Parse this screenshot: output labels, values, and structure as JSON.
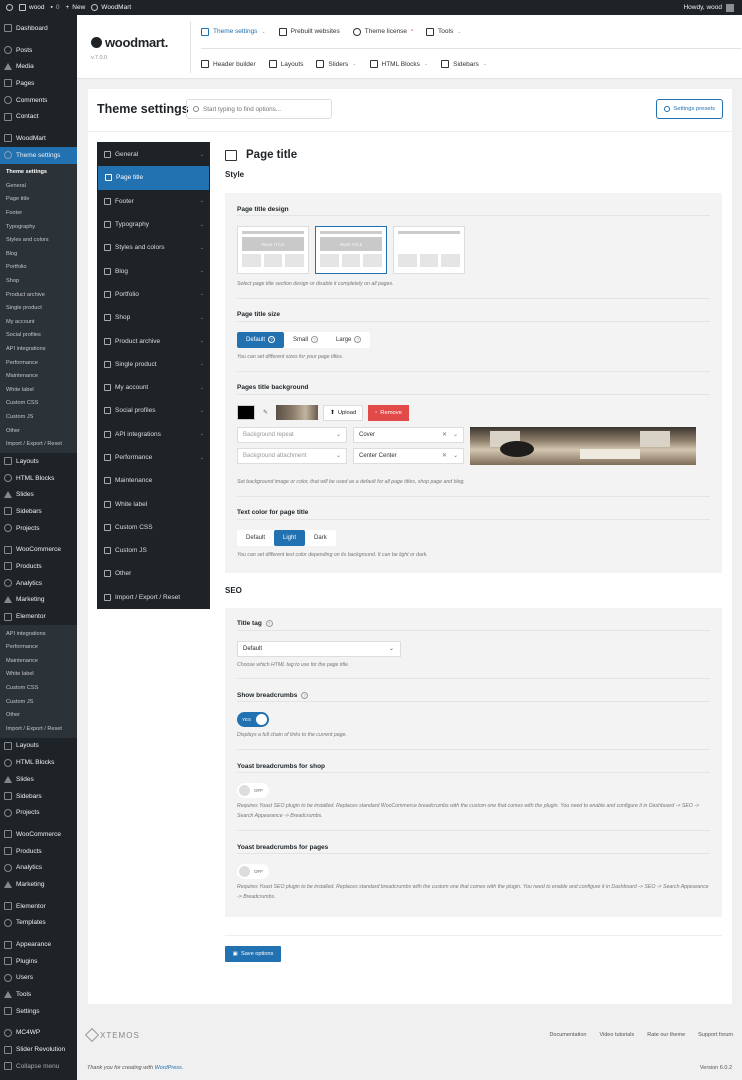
{
  "adminbar": {
    "site_name": "wood",
    "comments_count": "0",
    "new_label": "New",
    "plugin_label": "WoodMart",
    "greeting": "Howdy, wood"
  },
  "admin_menu": {
    "top": [
      "Dashboard",
      "Posts",
      "Media",
      "Pages",
      "Comments",
      "Contact",
      "WoodMart",
      "Theme settings"
    ],
    "theme_sub": [
      "Theme settings",
      "General",
      "Page title",
      "Footer",
      "Typography",
      "Styles and colors",
      "Blog",
      "Portfolio",
      "Shop",
      "Product archive",
      "Single product",
      "My account",
      "Social profiles",
      "API integrations",
      "Performance",
      "Maintenance",
      "White label",
      "Custom CSS",
      "Custom JS",
      "Other",
      "Import / Export / Reset"
    ],
    "mid1": [
      "Layouts",
      "HTML Blocks",
      "Slides",
      "Sidebars",
      "Projects",
      "WooCommerce",
      "Products",
      "Analytics",
      "Marketing",
      "Elementor"
    ],
    "overflow_sub": [
      "API integrations",
      "Performance",
      "Maintenance",
      "White label",
      "Custom CSS",
      "Custom JS",
      "Other",
      "Import / Export / Reset"
    ],
    "mid2": [
      "Layouts",
      "HTML Blocks",
      "Slides",
      "Sidebars",
      "Projects",
      "WooCommerce",
      "Products",
      "Analytics",
      "Marketing",
      "Elementor",
      "Templates",
      "Appearance",
      "Plugins",
      "Users",
      "Tools",
      "Settings",
      "MC4WP",
      "Slider Revolution",
      "Collapse menu"
    ]
  },
  "wd_header": {
    "logo": "woodmart.",
    "version": "v.7.0.0",
    "nav_top": [
      "Theme settings",
      "Prebuilt websites",
      "Theme license",
      "Tools"
    ],
    "license_mark": "*",
    "nav_bottom": [
      "Header builder",
      "Layouts",
      "Sliders",
      "HTML Blocks",
      "Sidebars"
    ]
  },
  "panel": {
    "title": "Theme settings",
    "search_placeholder": "Start typing to find options...",
    "presets_label": "Settings presets"
  },
  "options_sidebar": [
    "General",
    "Page title",
    "Footer",
    "Typography",
    "Styles and colors",
    "Blog",
    "Portfolio",
    "Shop",
    "Product archive",
    "Single product",
    "My account",
    "Social profiles",
    "API integrations",
    "Performance",
    "Maintenance",
    "White label",
    "Custom CSS",
    "Custom JS",
    "Other",
    "Import / Export / Reset"
  ],
  "content": {
    "section_title": "Page title",
    "style_heading": "Style",
    "design": {
      "label": "Page title design",
      "thumb_text": "PAGE TITLE",
      "desc": "Select page title section design or disable it completely on all pages."
    },
    "size": {
      "label": "Page title size",
      "options": [
        "Default",
        "Small",
        "Large"
      ],
      "selected": "Default",
      "desc": "You can set different sizes for your page titles."
    },
    "background": {
      "label": "Pages title background",
      "upload": "Upload",
      "remove": "Remove",
      "repeat_placeholder": "Background repeat",
      "size_value": "Cover",
      "attachment_placeholder": "Background attachment",
      "position_value": "Center Center",
      "desc": "Set background image or color, that will be used as a default for all page titles, shop page and blog."
    },
    "text_color": {
      "label": "Text color for page title",
      "options": [
        "Default",
        "Light",
        "Dark"
      ],
      "selected": "Light",
      "desc": "You can set different text color depending on its background. It can be light or dark."
    },
    "seo_heading": "SEO",
    "title_tag": {
      "label": "Title tag",
      "value": "Default",
      "desc": "Choose which HTML tag to use for the page title."
    },
    "breadcrumbs": {
      "label": "Show breadcrumbs",
      "toggle": "YES",
      "desc": "Displays a full chain of links to the current page."
    },
    "yoast_shop": {
      "label": "Yoast breadcrumbs for shop",
      "toggle": "OFF",
      "desc": "Requires Yoast SEO plugin to be installed. Replaces standard WooCommerce breadcrumbs with the custom one that comes with the plugin. You need to enable and configure it in Dashboard -> SEO -> Search Appearance -> Breadcrumbs."
    },
    "yoast_pages": {
      "label": "Yoast breadcrumbs for pages",
      "toggle": "OFF",
      "desc": "Requires Yoast SEO plugin to be installed. Replaces standard breadcrumbs with the custom one that comes with the plugin. You need to enable and configure it in Dashboard -> SEO -> Search Appearance -> Breadcrumbs."
    },
    "save_label": "Save options"
  },
  "footer": {
    "brand": "XTEMOS",
    "links": [
      "Documentation",
      "Video tutorials",
      "Rate our theme",
      "Support forum"
    ],
    "credit_prefix": "Thank you for creating with ",
    "credit_link": "WordPress",
    "credit_suffix": ".",
    "version": "Version 6.0.2"
  },
  "colors": {
    "accent": "#2271b1",
    "admin_dark": "#1d2327",
    "remove_red": "#e24a4a"
  }
}
